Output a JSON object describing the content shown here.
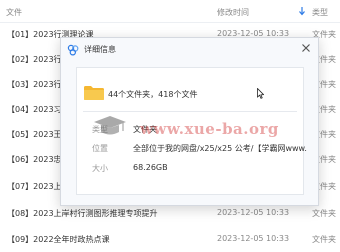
{
  "header": {
    "name_label": "文件",
    "date_label": "修改时间",
    "type_label": "类型"
  },
  "rows": [
    {
      "name": "【01】2023行测理论课",
      "date": "2023-12-05 10:33",
      "type": "文件夹"
    },
    {
      "name": "【02】2023行",
      "date": "",
      "type": "文件夹"
    },
    {
      "name": "【03】2023行",
      "date": "",
      "type": "文件夹"
    },
    {
      "name": "【04】2023习",
      "date": "",
      "type": "文件夹"
    },
    {
      "name": "【05】2023王",
      "date": "",
      "type": "文件夹"
    },
    {
      "name": "【06】2023忠",
      "date": "",
      "type": "文件夹"
    },
    {
      "name": "【07】2023上",
      "date": "",
      "type": "文件夹"
    },
    {
      "name": "【08】2023上岸村行测图形推理专项提升",
      "date": "2023-12-05 10:33",
      "type": "文件夹"
    },
    {
      "name": "【09】2022全年时政热点课",
      "date": "2023-12-05 10:33",
      "type": "文件夹"
    }
  ],
  "dialog": {
    "title": "详细信息",
    "summary": "44个文件夹，418个文件",
    "type_label": "类型",
    "type_value": "文件夹",
    "location_label": "位置",
    "location_value": "全部位于我的网盘/x25/x25 公考/【学霸网www.",
    "size_label": "大小",
    "size_value": "68.26GB"
  },
  "watermark": "www.xue-ba.org",
  "colors": {
    "folder": "#f5b731",
    "accent": "#2e7be6",
    "watermark": "#d23c3c"
  },
  "icons": [
    "sort-arrow-icon",
    "details-icon",
    "close-icon",
    "folder-icon",
    "mortarboard-icon",
    "mouse-cursor-icon"
  ]
}
